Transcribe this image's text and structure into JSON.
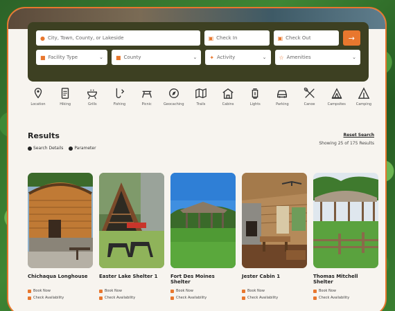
{
  "search": {
    "location_placeholder": "City, Town, County, or Lakeside",
    "checkin_placeholder": "Check In",
    "checkout_placeholder": "Check Out",
    "submit_icon": "arrow-right-icon",
    "facility_type": "Facility Type",
    "county": "County",
    "activity": "Activity",
    "amenities": "Amenities"
  },
  "categories": [
    {
      "label": "Location",
      "icon": "map-pin-icon"
    },
    {
      "label": "Hiking",
      "icon": "trail-icon"
    },
    {
      "label": "Grills",
      "icon": "grill-icon"
    },
    {
      "label": "Fishing",
      "icon": "fishing-icon"
    },
    {
      "label": "Picnic",
      "icon": "picnic-table-icon"
    },
    {
      "label": "Geocaching",
      "icon": "compass-icon"
    },
    {
      "label": "Trails",
      "icon": "map-icon"
    },
    {
      "label": "Cabins",
      "icon": "cabin-icon"
    },
    {
      "label": "Lights",
      "icon": "lantern-icon"
    },
    {
      "label": "Parking",
      "icon": "car-icon"
    },
    {
      "label": "Canoe",
      "icon": "paddles-icon"
    },
    {
      "label": "Campsites",
      "icon": "campsite-icon"
    },
    {
      "label": "Camping",
      "icon": "tent-icon"
    }
  ],
  "results": {
    "title": "Results",
    "reset": "Reset Search",
    "showing": "Showing 25 of 175 Results",
    "view_grid": "Search Details",
    "view_map": "Parameter"
  },
  "listings": [
    {
      "name": "Chichaqua Longhouse",
      "book": "Book Now",
      "check": "Check Availability"
    },
    {
      "name": "Easter Lake Shelter 1",
      "book": "Book Now",
      "check": "Check Availability"
    },
    {
      "name": "Fort Des Moines Shelter",
      "book": "Book Now",
      "check": "Check Availability"
    },
    {
      "name": "Jester Cabin 1",
      "book": "Book Now",
      "check": "Check Availability"
    },
    {
      "name": "Thomas Mitchell Shelter",
      "book": "Book Now",
      "check": "Check Availability"
    }
  ],
  "colors": {
    "accent": "#e8772e",
    "panel": "#3d4022"
  }
}
